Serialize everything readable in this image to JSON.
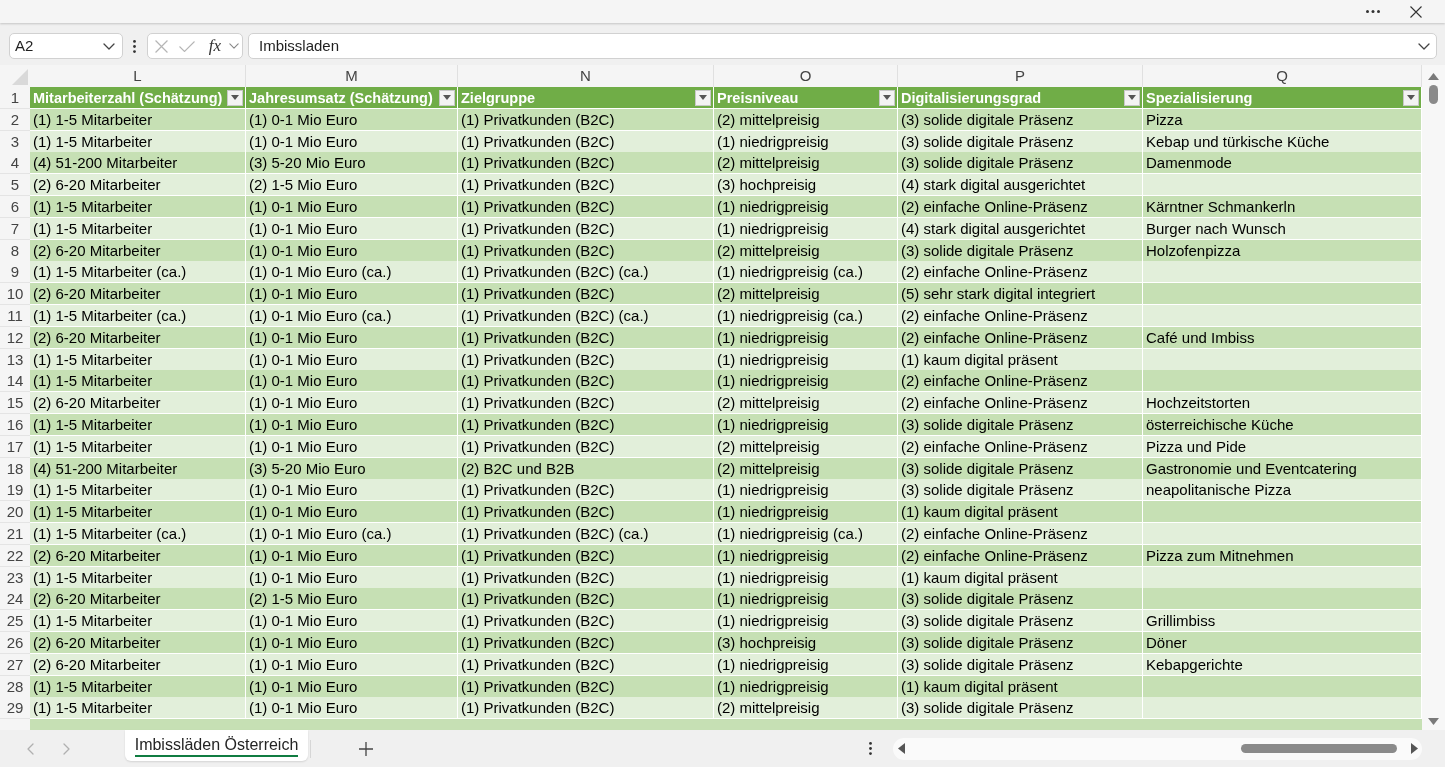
{
  "formula_bar": {
    "name_box": "A2",
    "function_label": "fx",
    "value": "Imbissladen"
  },
  "sheet": {
    "columns": [
      {
        "letter": "L",
        "header": "Mitarbeiterzahl (Schätzung)"
      },
      {
        "letter": "M",
        "header": "Jahresumsatz (Schätzung)"
      },
      {
        "letter": "N",
        "header": "Zielgruppe"
      },
      {
        "letter": "O",
        "header": "Preisniveau"
      },
      {
        "letter": "P",
        "header": "Digitalisierungsgrad"
      },
      {
        "letter": "Q",
        "header": "Spezialisierung"
      }
    ],
    "header_row_number": "1",
    "rows": [
      {
        "number": "2",
        "cells": [
          "(1) 1-5 Mitarbeiter",
          "(1) 0-1 Mio Euro",
          "(1) Privatkunden (B2C)",
          "(2) mittelpreisig",
          "(3) solide digitale Präsenz",
          "Pizza"
        ]
      },
      {
        "number": "3",
        "cells": [
          "(1) 1-5 Mitarbeiter",
          "(1) 0-1 Mio Euro",
          "(1) Privatkunden (B2C)",
          "(1) niedrigpreisig",
          "(3) solide digitale Präsenz",
          "Kebap und türkische Küche"
        ]
      },
      {
        "number": "4",
        "cells": [
          "(4) 51-200 Mitarbeiter",
          "(3) 5-20 Mio Euro",
          "(1) Privatkunden (B2C)",
          "(2) mittelpreisig",
          "(3) solide digitale Präsenz",
          "Damenmode"
        ]
      },
      {
        "number": "5",
        "cells": [
          "(2) 6-20 Mitarbeiter",
          "(2) 1-5 Mio Euro",
          "(1) Privatkunden (B2C)",
          "(3) hochpreisig",
          "(4) stark digital ausgerichtet"
        ]
      },
      {
        "number": "6",
        "cells": [
          "(1) 1-5 Mitarbeiter",
          "(1) 0-1 Mio Euro",
          "(1) Privatkunden (B2C)",
          "(1) niedrigpreisig",
          "(2) einfache Online-Präsenz",
          "Kärntner Schmankerln"
        ]
      },
      {
        "number": "7",
        "cells": [
          "(1) 1-5 Mitarbeiter",
          "(1) 0-1 Mio Euro",
          "(1) Privatkunden (B2C)",
          "(1) niedrigpreisig",
          "(4) stark digital ausgerichtet",
          "Burger nach Wunsch"
        ]
      },
      {
        "number": "8",
        "cells": [
          "(2) 6-20 Mitarbeiter",
          "(1) 0-1 Mio Euro",
          "(1) Privatkunden (B2C)",
          "(2) mittelpreisig",
          "(3) solide digitale Präsenz",
          "Holzofenpizza"
        ]
      },
      {
        "number": "9",
        "cells": [
          "(1) 1-5 Mitarbeiter (ca.)",
          "(1) 0-1 Mio Euro (ca.)",
          "(1) Privatkunden (B2C) (ca.)",
          "(1) niedrigpreisig (ca.)",
          "(2) einfache Online-Präsenz"
        ]
      },
      {
        "number": "10",
        "cells": [
          "(2) 6-20 Mitarbeiter",
          "(1) 0-1 Mio Euro",
          "(1) Privatkunden (B2C)",
          "(2) mittelpreisig",
          "(5) sehr stark digital integriert"
        ]
      },
      {
        "number": "11",
        "cells": [
          "(1) 1-5 Mitarbeiter (ca.)",
          "(1) 0-1 Mio Euro (ca.)",
          "(1) Privatkunden (B2C) (ca.)",
          "(1) niedrigpreisig (ca.)",
          "(2) einfache Online-Präsenz"
        ]
      },
      {
        "number": "12",
        "cells": [
          "(2) 6-20 Mitarbeiter",
          "(1) 0-1 Mio Euro",
          "(1) Privatkunden (B2C)",
          "(1) niedrigpreisig",
          "(2) einfache Online-Präsenz",
          "Café und Imbiss"
        ]
      },
      {
        "number": "13",
        "cells": [
          "(1) 1-5 Mitarbeiter",
          "(1) 0-1 Mio Euro",
          "(1) Privatkunden (B2C)",
          "(1) niedrigpreisig",
          "(1) kaum digital präsent"
        ]
      },
      {
        "number": "14",
        "cells": [
          "(1) 1-5 Mitarbeiter",
          "(1) 0-1 Mio Euro",
          "(1) Privatkunden (B2C)",
          "(1) niedrigpreisig",
          "(2) einfache Online-Präsenz"
        ]
      },
      {
        "number": "15",
        "cells": [
          "(2) 6-20 Mitarbeiter",
          "(1) 0-1 Mio Euro",
          "(1) Privatkunden (B2C)",
          "(2) mittelpreisig",
          "(2) einfache Online-Präsenz",
          "Hochzeitstorten"
        ]
      },
      {
        "number": "16",
        "cells": [
          "(1) 1-5 Mitarbeiter",
          "(1) 0-1 Mio Euro",
          "(1) Privatkunden (B2C)",
          "(1) niedrigpreisig",
          "(3) solide digitale Präsenz",
          "österreichische Küche"
        ]
      },
      {
        "number": "17",
        "cells": [
          "(1) 1-5 Mitarbeiter",
          "(1) 0-1 Mio Euro",
          "(1) Privatkunden (B2C)",
          "(2) mittelpreisig",
          "(2) einfache Online-Präsenz",
          "Pizza und Pide"
        ]
      },
      {
        "number": "18",
        "cells": [
          "(4) 51-200 Mitarbeiter",
          "(3) 5-20 Mio Euro",
          "(2) B2C und B2B",
          "(2) mittelpreisig",
          "(3) solide digitale Präsenz",
          "Gastronomie und Eventcatering"
        ]
      },
      {
        "number": "19",
        "cells": [
          "(1) 1-5 Mitarbeiter",
          "(1) 0-1 Mio Euro",
          "(1) Privatkunden (B2C)",
          "(1) niedrigpreisig",
          "(3) solide digitale Präsenz",
          "neapolitanische Pizza"
        ]
      },
      {
        "number": "20",
        "cells": [
          "(1) 1-5 Mitarbeiter",
          "(1) 0-1 Mio Euro",
          "(1) Privatkunden (B2C)",
          "(1) niedrigpreisig",
          "(1) kaum digital präsent"
        ]
      },
      {
        "number": "21",
        "cells": [
          "(1) 1-5 Mitarbeiter (ca.)",
          "(1) 0-1 Mio Euro (ca.)",
          "(1) Privatkunden (B2C) (ca.)",
          "(1) niedrigpreisig (ca.)",
          "(2) einfache Online-Präsenz"
        ]
      },
      {
        "number": "22",
        "cells": [
          "(2) 6-20 Mitarbeiter",
          "(1) 0-1 Mio Euro",
          "(1) Privatkunden (B2C)",
          "(1) niedrigpreisig",
          "(2) einfache Online-Präsenz",
          "Pizza zum Mitnehmen"
        ]
      },
      {
        "number": "23",
        "cells": [
          "(1) 1-5 Mitarbeiter",
          "(1) 0-1 Mio Euro",
          "(1) Privatkunden (B2C)",
          "(1) niedrigpreisig",
          "(1) kaum digital präsent"
        ]
      },
      {
        "number": "24",
        "cells": [
          "(2) 6-20 Mitarbeiter",
          "(2) 1-5 Mio Euro",
          "(1) Privatkunden (B2C)",
          "(1) niedrigpreisig",
          "(3) solide digitale Präsenz"
        ]
      },
      {
        "number": "25",
        "cells": [
          "(1) 1-5 Mitarbeiter",
          "(1) 0-1 Mio Euro",
          "(1) Privatkunden (B2C)",
          "(1) niedrigpreisig",
          "(3) solide digitale Präsenz",
          "Grillimbiss"
        ]
      },
      {
        "number": "26",
        "cells": [
          "(2) 6-20 Mitarbeiter",
          "(1) 0-1 Mio Euro",
          "(1) Privatkunden (B2C)",
          "(3) hochpreisig",
          "(3) solide digitale Präsenz",
          "Döner"
        ]
      },
      {
        "number": "27",
        "cells": [
          "(2) 6-20 Mitarbeiter",
          "(1) 0-1 Mio Euro",
          "(1) Privatkunden (B2C)",
          "(1) niedrigpreisig",
          "(3) solide digitale Präsenz",
          "Kebapgerichte"
        ]
      },
      {
        "number": "28",
        "cells": [
          "(1) 1-5 Mitarbeiter",
          "(1) 0-1 Mio Euro",
          "(1) Privatkunden (B2C)",
          "(1) niedrigpreisig",
          "(1) kaum digital präsent"
        ]
      },
      {
        "number": "29",
        "cells": [
          "(1) 1-5 Mitarbeiter",
          "(1) 0-1 Mio Euro",
          "(1) Privatkunden (B2C)",
          "(2) mittelpreisig",
          "(3) solide digitale Präsenz"
        ]
      }
    ]
  },
  "sheet_tabs": [
    {
      "label": "Imbissläden Österreich",
      "selected": true
    }
  ]
}
